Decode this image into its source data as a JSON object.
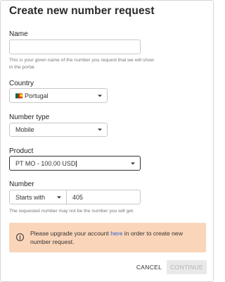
{
  "dialog": {
    "title": "Create new number request"
  },
  "name": {
    "label": "Name",
    "value": "",
    "helper": "This is your given name of the number you request that we will show in the portal."
  },
  "country": {
    "label": "Country",
    "value": "Portugal",
    "flag_icon": "portugal-flag-icon"
  },
  "number_type": {
    "label": "Number type",
    "value": "Mobile"
  },
  "product": {
    "label": "Product",
    "value": "PT MO - 100.00 USD"
  },
  "number": {
    "label": "Number",
    "match_value": "Starts with",
    "value": "405",
    "helper": "The requested number may not be the number you will get."
  },
  "alert": {
    "icon": "alert-circle-icon",
    "text_before": "Please upgrade your account ",
    "link_text": "here",
    "text_after": " in order to create new number request.",
    "background": "#fbd5b9",
    "link_color": "#2f5fd1"
  },
  "actions": {
    "cancel_label": "CANCEL",
    "continue_label": "CONTINUE"
  }
}
